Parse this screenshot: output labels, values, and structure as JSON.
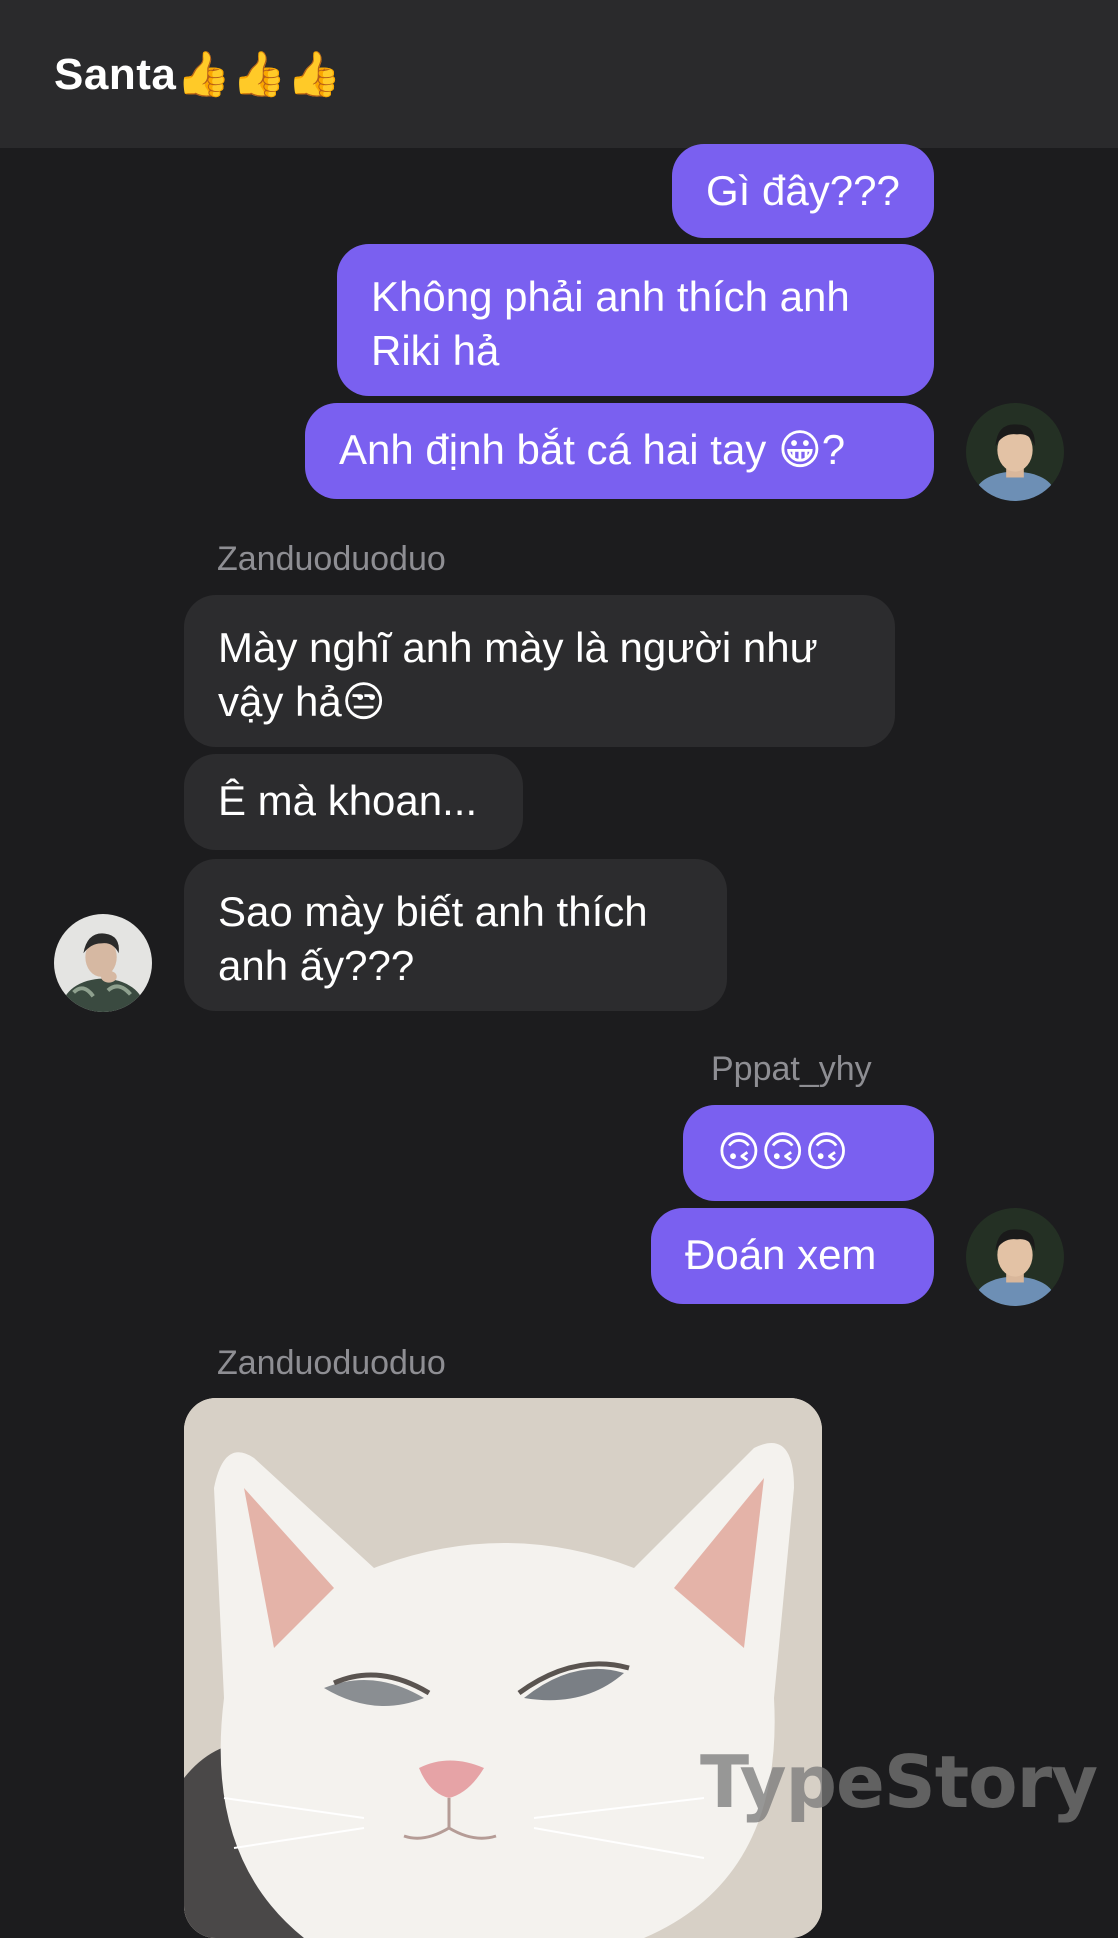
{
  "header": {
    "title": "Santa👍👍👍"
  },
  "messages": {
    "m1": "Gì đây???",
    "m2": "Không phải anh thích anh Riki hả",
    "m3": "Anh định bắt cá hai tay 😀?",
    "sender1": "Zanduoduoduo",
    "m4": "Mày nghĩ anh mày là người như vậy hả😒",
    "m5": "Ê mà khoan...",
    "m6": "Sao mày biết anh thích anh ấy???",
    "sender2": "Pppat_yhy",
    "m7": "🙃🙃🙃",
    "m8": "Đoán xem",
    "sender3": "Zanduoduoduo"
  },
  "watermark": "TypeStory",
  "colors": {
    "outgoing": "#7a60f0",
    "incoming": "#2c2c2e",
    "background": "#1c1c1e",
    "header": "#2a2a2c"
  }
}
